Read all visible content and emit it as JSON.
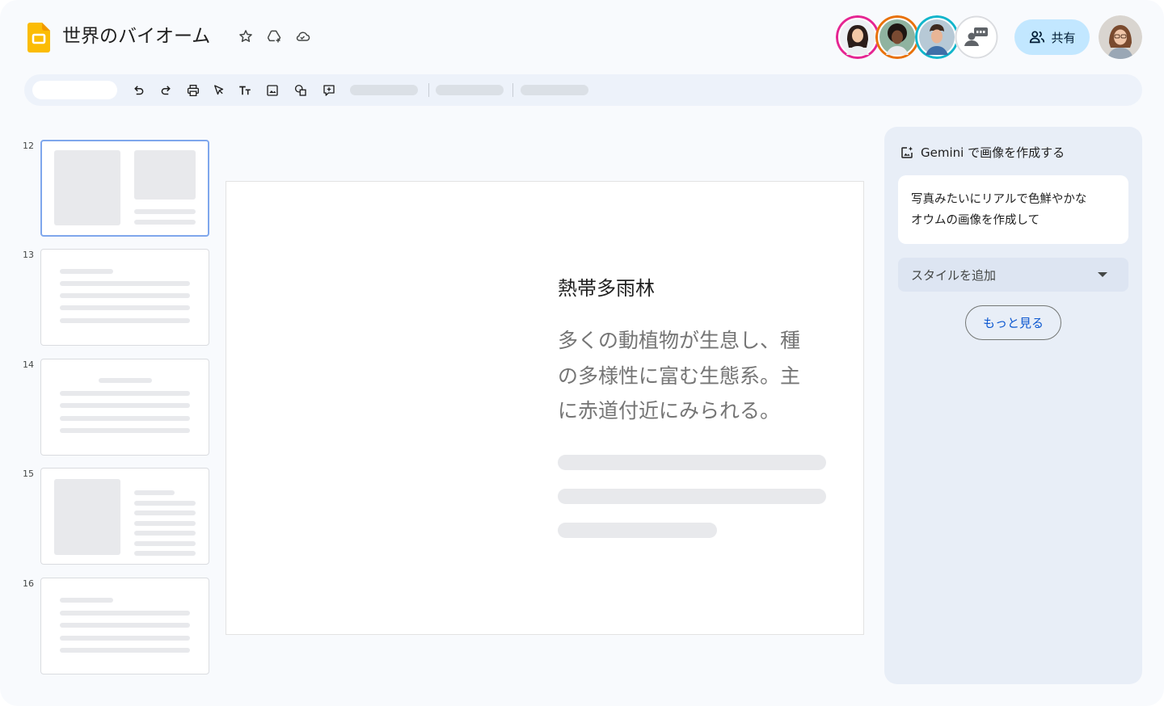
{
  "app": {
    "title": "世界のバイオーム",
    "icon_names": [
      "slides-logo-icon",
      "star-icon",
      "drive-add-icon",
      "cloud-saved-icon"
    ]
  },
  "header": {
    "share_label": "共有",
    "avatars": [
      {
        "name": "collaborator-1",
        "ring_color": "#e52592"
      },
      {
        "name": "collaborator-2",
        "ring_color": "#e8710a"
      },
      {
        "name": "collaborator-3",
        "ring_color": "#12b5cb"
      },
      {
        "name": "more-collaborators",
        "ring_color": "#dadce0"
      },
      {
        "name": "current-user",
        "ring_color": "none"
      }
    ]
  },
  "toolbar": {
    "icons": [
      "undo-icon",
      "redo-icon",
      "print-icon",
      "select-cursor-icon",
      "text-box-icon",
      "insert-image-icon",
      "shapes-icon",
      "new-slide-icon"
    ]
  },
  "filmstrip": {
    "slides": [
      {
        "number": "12",
        "selected": true
      },
      {
        "number": "13",
        "selected": false
      },
      {
        "number": "14",
        "selected": false
      },
      {
        "number": "15",
        "selected": false
      },
      {
        "number": "16",
        "selected": false
      }
    ]
  },
  "slide": {
    "heading": "熱帯多雨林",
    "body_lines": [
      "多くの動植物が生息し、種",
      "の多様性に富む生態系。主",
      "に赤道付近にみられる。"
    ]
  },
  "gemini": {
    "title": "Gemini で画像を作成する",
    "prompt_lines": [
      "写真みたいにリアルで色鮮やかな",
      "オウムの画像を作成して"
    ],
    "style_label": "スタイルを追加",
    "more_label": "もっと見る"
  },
  "colors": {
    "accent": "#0b57d0",
    "share_bg": "#c2e7ff",
    "panel_bg": "#e8eef7",
    "selected_thumb_border": "#7fa7ec",
    "logo_yellow": "#fbbc04"
  }
}
